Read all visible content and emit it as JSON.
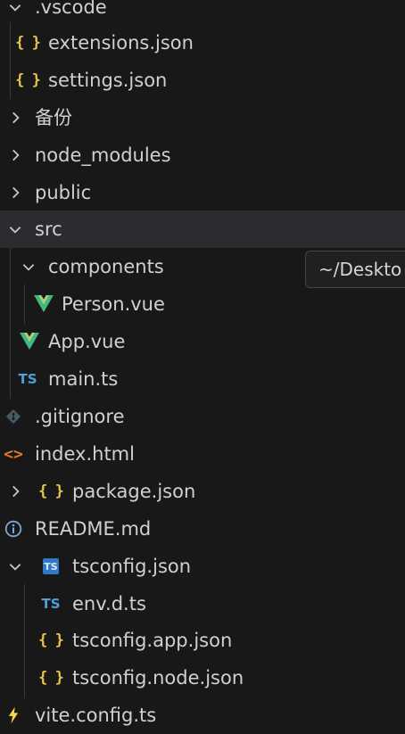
{
  "explorer": {
    "items": [
      {
        "label": ".vscode",
        "type": "folder",
        "expanded": true
      },
      {
        "label": "extensions.json",
        "type": "json"
      },
      {
        "label": "settings.json",
        "type": "json"
      },
      {
        "label": "备份",
        "type": "folder",
        "expanded": false
      },
      {
        "label": "node_modules",
        "type": "folder",
        "expanded": false
      },
      {
        "label": "public",
        "type": "folder",
        "expanded": false
      },
      {
        "label": "src",
        "type": "folder",
        "expanded": true,
        "selected": true
      },
      {
        "label": "components",
        "type": "folder",
        "expanded": true
      },
      {
        "label": "Person.vue",
        "type": "vue"
      },
      {
        "label": "App.vue",
        "type": "vue"
      },
      {
        "label": "main.ts",
        "type": "ts"
      },
      {
        "label": ".gitignore",
        "type": "git"
      },
      {
        "label": "index.html",
        "type": "html"
      },
      {
        "label": "package.json",
        "type": "json",
        "expandable": true,
        "expanded": false
      },
      {
        "label": "README.md",
        "type": "info"
      },
      {
        "label": "tsconfig.json",
        "type": "tsconfig",
        "expandable": true,
        "expanded": true
      },
      {
        "label": "env.d.ts",
        "type": "ts"
      },
      {
        "label": "tsconfig.app.json",
        "type": "json"
      },
      {
        "label": "tsconfig.node.json",
        "type": "json"
      },
      {
        "label": "vite.config.ts",
        "type": "vite"
      }
    ],
    "icons": {
      "json": "{ }",
      "ts": "TS",
      "html": "<>"
    }
  },
  "tooltip": {
    "text": "~/Deskto"
  },
  "colors": {
    "background": "#181818",
    "selected_row": "#2b2c2f",
    "json_icon": "#e8c54a",
    "ts_icon": "#4f9fd9",
    "vue_icon_light": "#41b883",
    "html_icon": "#e37933",
    "vite_icon": "#f6d64a"
  }
}
